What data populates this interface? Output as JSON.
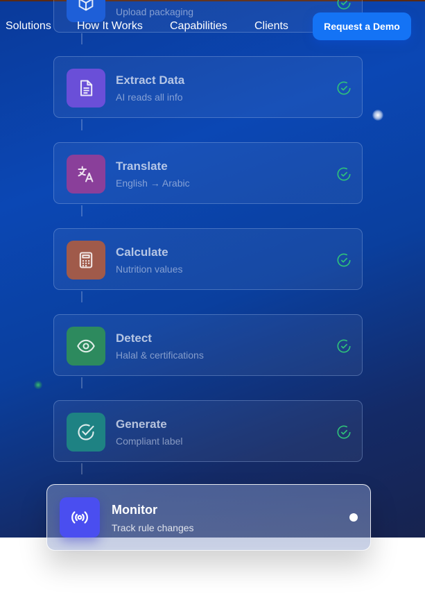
{
  "nav": {
    "links": [
      "Solutions",
      "How It Works",
      "Capabilities",
      "Clients"
    ],
    "cta": "Request a Demo"
  },
  "steps": [
    {
      "title": "",
      "subtitle": "Upload packaging",
      "icon": "box-icon",
      "color": "#1e5fd8",
      "status": "done"
    },
    {
      "title": "Extract Data",
      "subtitle": "AI reads all info",
      "icon": "document-icon",
      "color": "#6a4fd8",
      "status": "done"
    },
    {
      "title": "Translate",
      "subtitle": "English → Arabic",
      "icon": "translate-icon",
      "color": "#8a3f9a",
      "status": "done"
    },
    {
      "title": "Calculate",
      "subtitle": "Nutrition values",
      "icon": "calculator-icon",
      "color": "#a05a4a",
      "status": "done"
    },
    {
      "title": "Detect",
      "subtitle": "Halal & certifications",
      "icon": "eye-icon",
      "color": "#2d8a5e",
      "status": "done"
    },
    {
      "title": "Generate",
      "subtitle": "Compliant label",
      "icon": "check-circle-icon",
      "color": "#1e8283",
      "status": "done"
    }
  ],
  "active_step": {
    "title": "Monitor",
    "subtitle": "Track rule changes",
    "icon": "broadcast-icon",
    "color": "#4a4ef0",
    "status": "active"
  },
  "colors": {
    "check": "#2fc27a",
    "cta": "#1473f5",
    "hero_bg": "#0b47b4"
  }
}
